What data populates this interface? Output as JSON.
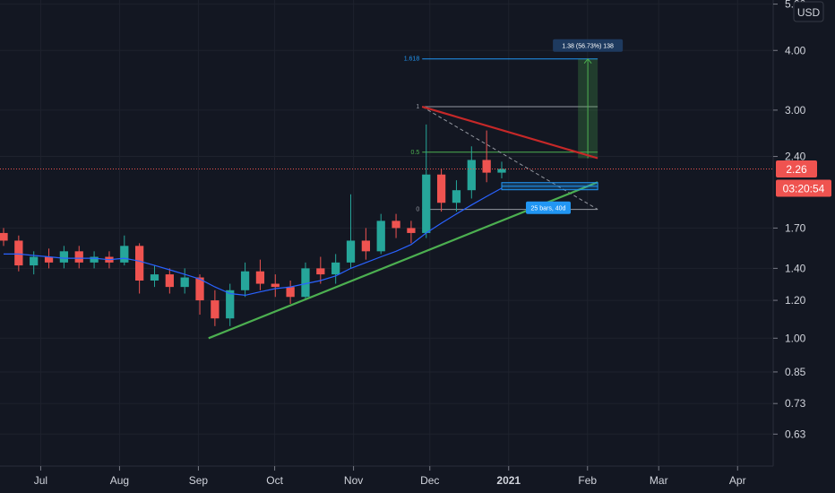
{
  "chart_data": {
    "type": "candlestick",
    "title": "",
    "currency": "USD",
    "y_scale": "log",
    "ylim": [
      0.54,
      5.1
    ],
    "y_ticks": [
      "5.00",
      "4.00",
      "3.00",
      "2.40",
      "1.70",
      "1.40",
      "1.20",
      "1.00",
      "0.85",
      "0.73",
      "0.63"
    ],
    "y_tick_values": [
      5.0,
      4.0,
      3.0,
      2.4,
      1.7,
      1.4,
      1.2,
      1.0,
      0.85,
      0.73,
      0.63
    ],
    "x_ticks": [
      {
        "label": "Jul",
        "date": "2020-07-01"
      },
      {
        "label": "Aug",
        "date": "2020-08-01"
      },
      {
        "label": "Sep",
        "date": "2020-09-01"
      },
      {
        "label": "Oct",
        "date": "2020-10-01"
      },
      {
        "label": "Nov",
        "date": "2020-11-01"
      },
      {
        "label": "Dec",
        "date": "2020-12-01"
      },
      {
        "label": "2021",
        "date": "2021-01-01",
        "bold": true
      },
      {
        "label": "Feb",
        "date": "2021-02-01"
      },
      {
        "label": "Mar",
        "date": "2021-03-01"
      },
      {
        "label": "Apr",
        "date": "2021-04-01"
      }
    ],
    "xlim": [
      "2020-06-15",
      "2021-04-15"
    ],
    "last_price": "2.26",
    "last_price_value": 2.26,
    "countdown": "03:20:54",
    "up_color": "#26a69a",
    "down_color": "#ef5350",
    "ma_color": "#2962ff",
    "series": [
      {
        "period": "Jun 16",
        "open": 1.66,
        "close": 1.6,
        "high": 1.7,
        "low": 1.56
      },
      {
        "period": "Jun 22",
        "open": 1.6,
        "close": 1.42,
        "high": 1.64,
        "low": 1.38
      },
      {
        "period": "Jun 28",
        "open": 1.42,
        "close": 1.48,
        "high": 1.52,
        "low": 1.36
      },
      {
        "period": "Jul 04",
        "open": 1.48,
        "close": 1.44,
        "high": 1.54,
        "low": 1.4
      },
      {
        "period": "Jul 10",
        "open": 1.44,
        "close": 1.52,
        "high": 1.56,
        "low": 1.4
      },
      {
        "period": "Jul 16",
        "open": 1.52,
        "close": 1.44,
        "high": 1.56,
        "low": 1.4
      },
      {
        "period": "Jul 22",
        "open": 1.44,
        "close": 1.48,
        "high": 1.52,
        "low": 1.4
      },
      {
        "period": "Jul 28",
        "open": 1.48,
        "close": 1.44,
        "high": 1.52,
        "low": 1.4
      },
      {
        "period": "Aug 03",
        "open": 1.44,
        "close": 1.56,
        "high": 1.64,
        "low": 1.42
      },
      {
        "period": "Aug 09",
        "open": 1.56,
        "close": 1.32,
        "high": 1.58,
        "low": 1.24
      },
      {
        "period": "Aug 15",
        "open": 1.32,
        "close": 1.36,
        "high": 1.42,
        "low": 1.28
      },
      {
        "period": "Aug 21",
        "open": 1.36,
        "close": 1.28,
        "high": 1.4,
        "low": 1.24
      },
      {
        "period": "Aug 27",
        "open": 1.28,
        "close": 1.34,
        "high": 1.4,
        "low": 1.24
      },
      {
        "period": "Sep 02",
        "open": 1.34,
        "close": 1.2,
        "high": 1.36,
        "low": 1.12
      },
      {
        "period": "Sep 08",
        "open": 1.2,
        "close": 1.1,
        "high": 1.26,
        "low": 1.06
      },
      {
        "period": "Sep 14",
        "open": 1.1,
        "close": 1.26,
        "high": 1.3,
        "low": 1.06
      },
      {
        "period": "Sep 20",
        "open": 1.26,
        "close": 1.38,
        "high": 1.44,
        "low": 1.22
      },
      {
        "period": "Sep 26",
        "open": 1.38,
        "close": 1.3,
        "high": 1.46,
        "low": 1.26
      },
      {
        "period": "Oct 02",
        "open": 1.3,
        "close": 1.28,
        "high": 1.36,
        "low": 1.22
      },
      {
        "period": "Oct 08",
        "open": 1.28,
        "close": 1.22,
        "high": 1.32,
        "low": 1.18
      },
      {
        "period": "Oct 14",
        "open": 1.22,
        "close": 1.4,
        "high": 1.44,
        "low": 1.2
      },
      {
        "period": "Oct 20",
        "open": 1.4,
        "close": 1.36,
        "high": 1.48,
        "low": 1.3
      },
      {
        "period": "Oct 26",
        "open": 1.36,
        "close": 1.44,
        "high": 1.5,
        "low": 1.3
      },
      {
        "period": "Nov 01",
        "open": 1.44,
        "close": 1.6,
        "high": 2.0,
        "low": 1.4
      },
      {
        "period": "Nov 07",
        "open": 1.6,
        "close": 1.52,
        "high": 1.7,
        "low": 1.46
      },
      {
        "period": "Nov 13",
        "open": 1.52,
        "close": 1.76,
        "high": 1.82,
        "low": 1.5
      },
      {
        "period": "Nov 19",
        "open": 1.76,
        "close": 1.7,
        "high": 1.82,
        "low": 1.62
      },
      {
        "period": "Nov 25",
        "open": 1.7,
        "close": 1.66,
        "high": 1.76,
        "low": 1.58
      },
      {
        "period": "Dec 01",
        "open": 1.66,
        "close": 2.2,
        "high": 2.8,
        "low": 1.62
      },
      {
        "period": "Dec 07",
        "open": 2.2,
        "close": 1.92,
        "high": 2.26,
        "low": 1.84
      },
      {
        "period": "Dec 13",
        "open": 1.92,
        "close": 2.04,
        "high": 2.14,
        "low": 1.84
      },
      {
        "period": "Dec 19",
        "open": 2.04,
        "close": 2.36,
        "high": 2.52,
        "low": 1.96
      },
      {
        "period": "Dec 25",
        "open": 2.36,
        "close": 2.22,
        "high": 2.72,
        "low": 2.12
      },
      {
        "period": "Dec 31",
        "open": 2.22,
        "close": 2.26,
        "high": 2.34,
        "low": 2.16
      }
    ],
    "moving_average": [
      1.5,
      1.5,
      1.49,
      1.48,
      1.47,
      1.47,
      1.47,
      1.46,
      1.47,
      1.45,
      1.42,
      1.39,
      1.36,
      1.33,
      1.28,
      1.24,
      1.23,
      1.25,
      1.27,
      1.28,
      1.3,
      1.32,
      1.35,
      1.4,
      1.44,
      1.48,
      1.52,
      1.57,
      1.66,
      1.74,
      1.82,
      1.9,
      1.98,
      2.06
    ],
    "drawings": {
      "support_trendline": {
        "color": "#4caf50",
        "start": {
          "date": "2020-09-05",
          "value": 1.0
        },
        "end": {
          "date": "2021-02-05",
          "value": 2.12
        }
      },
      "resistance_trendline": {
        "color": "#c62828",
        "start": {
          "date": "2020-11-28",
          "value": 3.05
        },
        "end": {
          "date": "2021-02-05",
          "value": 2.38
        }
      },
      "fib_levels": [
        {
          "label": "1.618",
          "value": 3.84,
          "color": "#2196f3"
        },
        {
          "label": "1",
          "value": 3.05,
          "color": "#9598a1"
        },
        {
          "label": "0.5",
          "value": 2.45,
          "color": "#4caf50"
        },
        {
          "label": "0",
          "value": 1.86,
          "color": "#9598a1"
        }
      ],
      "projection_label": "1.38 (56.73%) 138",
      "range_label": "25 bars, 40d"
    }
  }
}
